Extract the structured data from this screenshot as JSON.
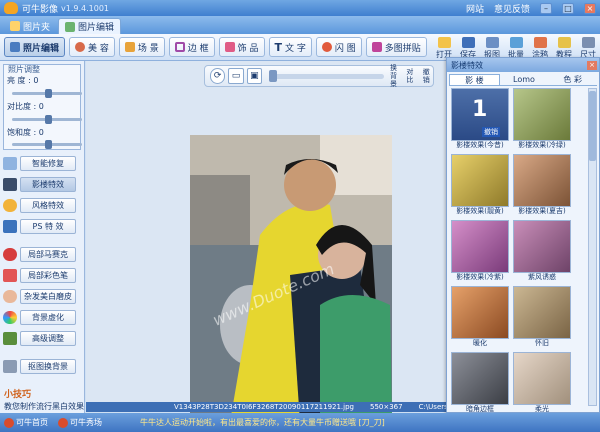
{
  "title": {
    "app": "可牛影像",
    "version": "v1.9.4.1001",
    "links": [
      "网站",
      "意见反馈"
    ]
  },
  "window_buttons": [
    "–",
    "□",
    "×"
  ],
  "tabs": [
    "图片夹",
    "图片编辑"
  ],
  "toolbar": {
    "buttons": [
      "照片编辑",
      "美 容",
      "场 景",
      "边 框",
      "饰 品",
      "文 字",
      "闪 图",
      "多图拼贴"
    ],
    "right": [
      "打开",
      "保存",
      "报图",
      "批量",
      "涂鸦",
      "教程",
      "尺寸"
    ]
  },
  "adjust": {
    "header": "照片调整",
    "rows": [
      {
        "label": "亮  度 : 0",
        "value": 0
      },
      {
        "label": "对比度 : 0",
        "value": 0
      },
      {
        "label": "饱和度 : 0",
        "value": 0
      }
    ]
  },
  "left_buttons": [
    "智能修复",
    "影楼特效",
    "风格特效",
    "PS 特 效",
    "局部马赛克",
    "局部彩色笔",
    "杂发美白磨皮",
    "背景虚化",
    "高级调整",
    "抠图换背景"
  ],
  "tips": {
    "title": "小技巧",
    "line": "教您制作流行黑白效果"
  },
  "center": {
    "ctrl_labels": [
      "换背景",
      "对比",
      "撤销"
    ],
    "watermark": "www.Duote.com"
  },
  "status": {
    "filename": "V1343P28T3D234T0I6F3268T20090117211921.jpg",
    "dims": "550×367",
    "path": "C:\\Users\\Spring\\"
  },
  "fx_panel": {
    "title": "影楼特效",
    "tabs": [
      "影 楼",
      "Lomo",
      "色 彩"
    ],
    "items": [
      "影楼效果(今昔)",
      "影楼效果(冷绿)",
      "影楼效果(靓黄)",
      "影楼效果(夏吉)",
      "影楼效果(冷紫)",
      "紫风诱惑",
      "暖化",
      "怀旧",
      "暗角边框",
      "柔光"
    ],
    "badge": "1",
    "badge_text": "撤销"
  },
  "bottom": {
    "items": [
      "可牛首页",
      "可牛秀场"
    ],
    "news": "牛牛达人运动开始啦，有出最喜爱的你，还有大量牛币赠送哦 [刀_刀]"
  },
  "colors": {
    "accent": "#3e74c2"
  }
}
